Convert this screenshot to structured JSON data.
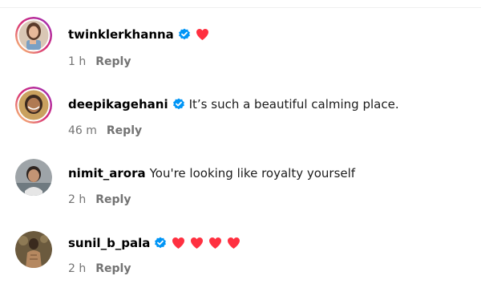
{
  "accent_colors": {
    "verified_badge": "#0095f6",
    "heart": "#ff3040",
    "meta_text": "#737373",
    "story_ring_start": "#feda75",
    "story_ring_mid": "#d62976",
    "story_ring_end": "#962fbf"
  },
  "comments": [
    {
      "username": "twinklerkhanna",
      "verified": true,
      "text": "",
      "hearts": 1,
      "time": "1 h",
      "reply_label": "Reply",
      "avatar_icon": "profile-photo-with-story-ring"
    },
    {
      "username": "deepikagehani",
      "verified": true,
      "text": "It’s such a beautiful calming place.",
      "hearts": 0,
      "time": "46 m",
      "reply_label": "Reply",
      "avatar_icon": "profile-photo-with-story-ring"
    },
    {
      "username": "nimit_arora",
      "verified": false,
      "text": "You're looking like royalty yourself",
      "hearts": 0,
      "time": "2 h",
      "reply_label": "Reply",
      "avatar_icon": "profile-photo"
    },
    {
      "username": "sunil_b_pala",
      "verified": true,
      "text": "",
      "hearts": 4,
      "time": "2 h",
      "reply_label": "Reply",
      "avatar_icon": "profile-photo"
    }
  ]
}
